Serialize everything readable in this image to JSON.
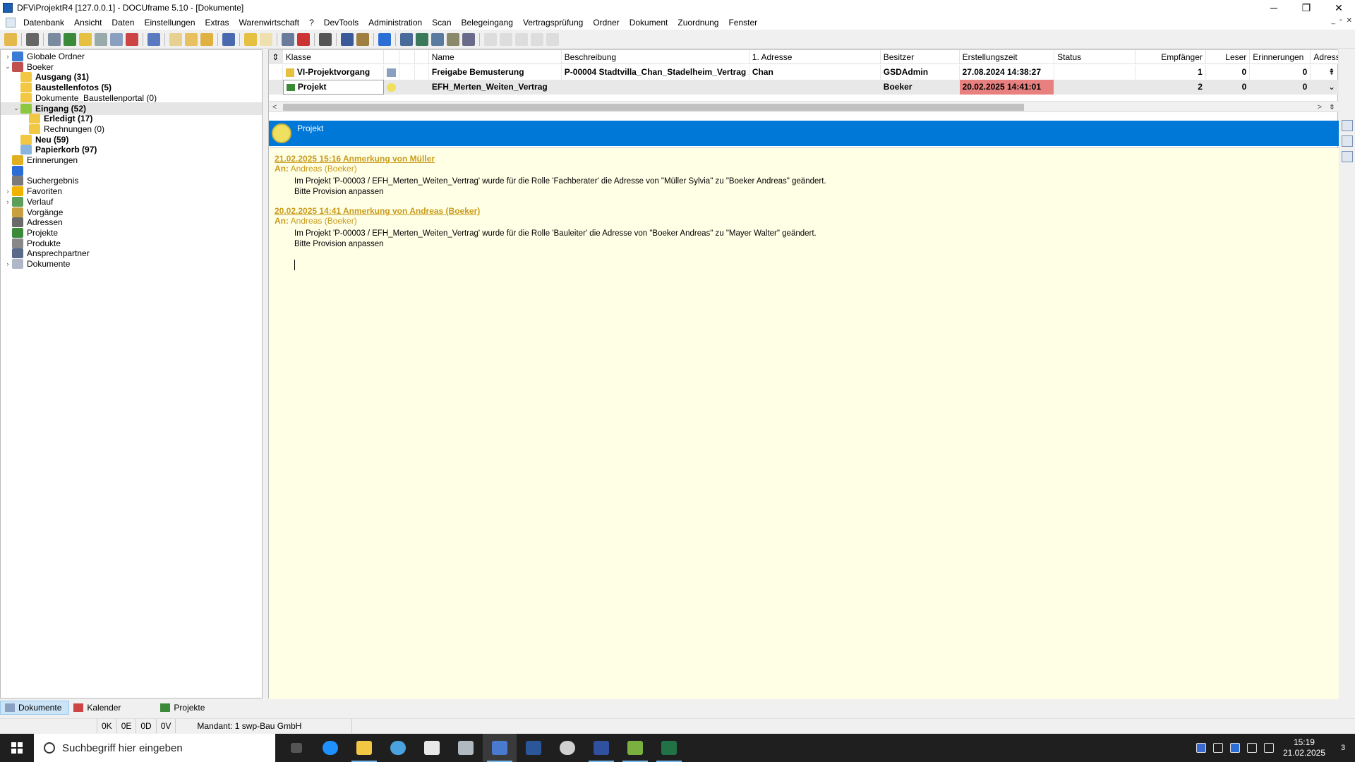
{
  "window": {
    "title": "DFViProjektR4 [127.0.0.1] - DOCUframe 5.10 - [Dokumente]",
    "minimize": "─",
    "restore": "❐",
    "close": "✕"
  },
  "menu": [
    "Datenbank",
    "Ansicht",
    "Daten",
    "Einstellungen",
    "Extras",
    "Warenwirtschaft",
    "?",
    "DevTools",
    "Administration",
    "Scan",
    "Belegeingang",
    "Vertragsprüfung",
    "Ordner",
    "Dokument",
    "Zuordnung",
    "Fenster"
  ],
  "mdi": {
    "min": "_",
    "restore": "▫",
    "close": "✕"
  },
  "tree": [
    {
      "label": "Globale Ordner",
      "bold": false,
      "level": 0,
      "expander": "›",
      "icon": "globe-icon",
      "color": "#3a7bd5"
    },
    {
      "label": "Boeker",
      "bold": false,
      "level": 0,
      "expander": "⌄",
      "icon": "user-icon",
      "color": "#c0504d"
    },
    {
      "label": "Ausgang (31)",
      "bold": true,
      "level": 1,
      "expander": "",
      "icon": "folder-out-icon",
      "color": "#f2c744"
    },
    {
      "label": "Baustellenfotos (5)",
      "bold": true,
      "level": 1,
      "expander": "",
      "icon": "folder-icon",
      "color": "#f2c744"
    },
    {
      "label": "Dokumente_Baustellenportal (0)",
      "bold": false,
      "level": 1,
      "expander": "",
      "icon": "folder-icon",
      "color": "#f2c744"
    },
    {
      "label": "Eingang (52)",
      "bold": true,
      "level": 1,
      "expander": "⌄",
      "icon": "folder-in-icon",
      "color": "#8dc63f",
      "selected": true
    },
    {
      "label": "Erledigt (17)",
      "bold": true,
      "level": 2,
      "expander": "",
      "icon": "folder-icon",
      "color": "#f2c744"
    },
    {
      "label": "Rechnungen (0)",
      "bold": false,
      "level": 2,
      "expander": "",
      "icon": "folder-icon",
      "color": "#f2c744"
    },
    {
      "label": "Neu (59)",
      "bold": true,
      "level": 1,
      "expander": "",
      "icon": "folder-new-icon",
      "color": "#f2c744"
    },
    {
      "label": "Papierkorb (97)",
      "bold": true,
      "level": 1,
      "expander": "",
      "icon": "trash-icon",
      "color": "#8ab4e0"
    },
    {
      "label": "Erinnerungen",
      "bold": false,
      "level": 0,
      "expander": "",
      "icon": "bell-icon",
      "color": "#e0b020"
    },
    {
      "label": "",
      "bold": false,
      "level": 0,
      "expander": "",
      "icon": "pin-icon",
      "color": "#2b6fd6"
    },
    {
      "label": "Suchergebnis",
      "bold": false,
      "level": 0,
      "expander": "",
      "icon": "search-result-icon",
      "color": "#7a7a7a"
    },
    {
      "label": "Favoriten",
      "bold": false,
      "level": 0,
      "expander": "›",
      "icon": "star-icon",
      "color": "#f0b400"
    },
    {
      "label": "Verlauf",
      "bold": false,
      "level": 0,
      "expander": "›",
      "icon": "history-icon",
      "color": "#5aa05a"
    },
    {
      "label": "Vorgänge",
      "bold": false,
      "level": 0,
      "expander": "",
      "icon": "process-icon",
      "color": "#c8a040"
    },
    {
      "label": "Adressen",
      "bold": false,
      "level": 0,
      "expander": "",
      "icon": "address-icon",
      "color": "#6a6a6a"
    },
    {
      "label": "Projekte",
      "bold": false,
      "level": 0,
      "expander": "",
      "icon": "project-icon",
      "color": "#3a8a3a"
    },
    {
      "label": "Produkte",
      "bold": false,
      "level": 0,
      "expander": "",
      "icon": "product-icon",
      "color": "#888888"
    },
    {
      "label": "Ansprechpartner",
      "bold": false,
      "level": 0,
      "expander": "",
      "icon": "contact-icon",
      "color": "#5a6a8a"
    },
    {
      "label": "Dokumente",
      "bold": false,
      "level": 0,
      "expander": "›",
      "icon": "document-icon",
      "color": "#b0b8c8"
    }
  ],
  "grid": {
    "sort_icon": "⇕",
    "headers": [
      "Klasse",
      "",
      "",
      "",
      "Name",
      "Beschreibung",
      "1. Adresse",
      "Besitzer",
      "Erstellungszeit",
      "Status",
      "Empfänger",
      "Leser",
      "Erinnerungen",
      "Adress"
    ],
    "rows": [
      {
        "klasse": "VI-Projektvorgang",
        "name": "Freigabe Bemusterung",
        "beschreibung": "P-00004 Stadtvilla_Chan_Stadelheim_Vertrag /",
        "adresse": "Chan",
        "besitzer": "GSDAdmin",
        "zeit": "27.08.2024 14:38:27",
        "status": "",
        "empfaenger": "1",
        "leser": "0",
        "erinnerungen": "0"
      },
      {
        "klasse": "Projekt",
        "name": "EFH_Merten_Weiten_Vertrag",
        "beschreibung": "",
        "adresse": "",
        "besitzer": "Boeker",
        "zeit": "20.02.2025 14:41:01",
        "status": "",
        "empfaenger": "2",
        "leser": "0",
        "erinnerungen": "0"
      }
    ],
    "highlight_color": "#e88080",
    "scroll_left": "<",
    "scroll_right": ">"
  },
  "detail": {
    "title": "Projekt",
    "notes": [
      {
        "header": "21.02.2025 15:16 Anmerkung von Müller",
        "to_label": "An:",
        "to": "Andreas (Boeker)",
        "line1": "Im Projekt 'P-00003 / EFH_Merten_Weiten_Vertrag' wurde für die Rolle 'Fachberater' die Adresse von \"Müller Sylvia\" zu \"Boeker Andreas\" geändert.",
        "line2": "Bitte Provision anpassen"
      },
      {
        "header": "20.02.2025 14:41 Anmerkung von Andreas (Boeker)",
        "to_label": "An:",
        "to": "Andreas (Boeker)",
        "line1": "Im Projekt 'P-00003 / EFH_Merten_Weiten_Vertrag' wurde für die Rolle 'Bauleiter' die Adresse von \"Boeker Andreas\" zu \"Mayer Walter\" geändert.",
        "line2": "Bitte Provision anpassen"
      }
    ],
    "accent": "#0078d7"
  },
  "bottom_tabs": [
    {
      "label": "Dokumente",
      "active": true
    },
    {
      "label": "Kalender",
      "active": false
    },
    {
      "label": "Projekte",
      "active": false
    }
  ],
  "status": {
    "a": "0K",
    "b": "0E",
    "c": "0D",
    "d": "0V",
    "mandant": "Mandant: 1 swp-Bau GmbH"
  },
  "taskbar": {
    "search_placeholder": "Suchbegriff hier eingeben",
    "time": "15:19",
    "date": "21.02.2025",
    "notifications": "3"
  }
}
